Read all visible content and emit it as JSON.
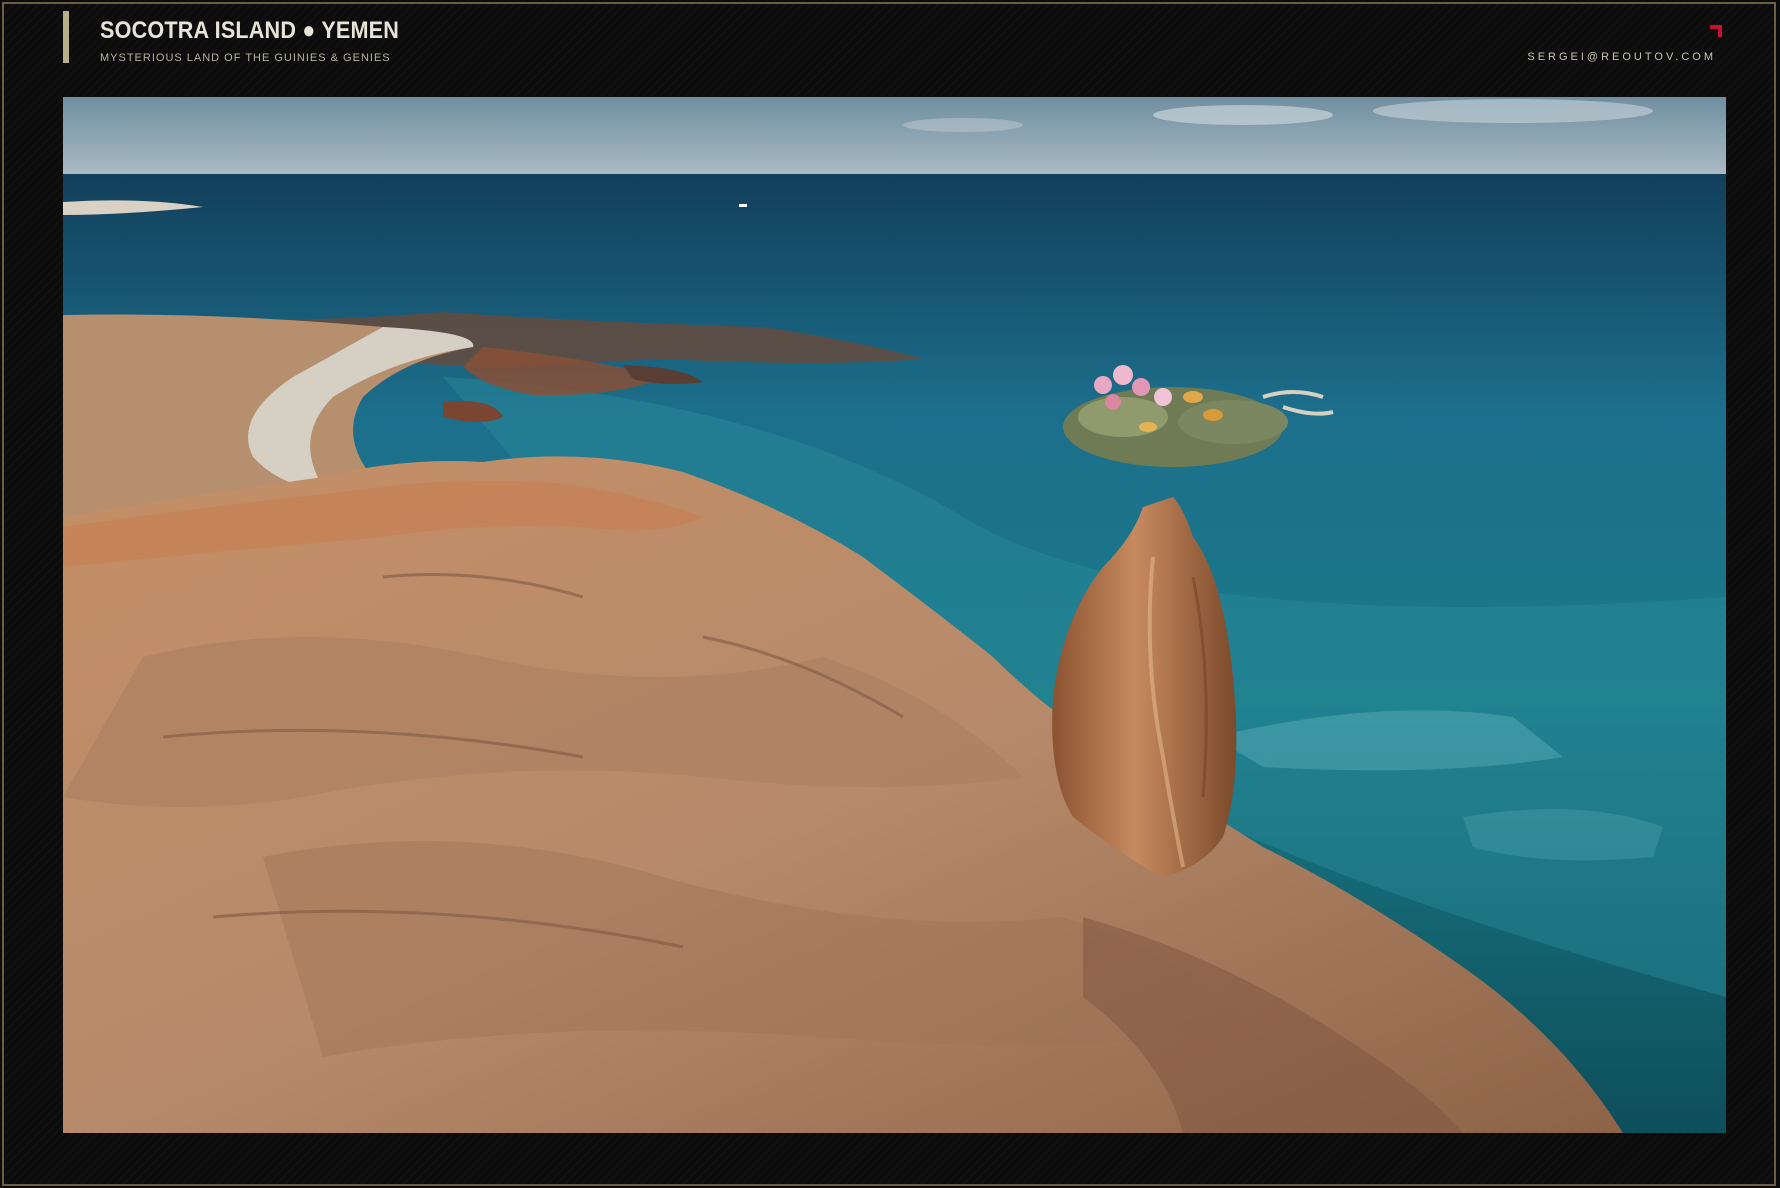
{
  "header": {
    "title": "SOCOTRA ISLAND ● YEMEN",
    "subtitle": "MYSTERIOUS LAND OF THE GUINIES & GENIES",
    "email": "SERGEI@REOUTOV.COM"
  },
  "photo": {
    "subject": "bottle tree on coastal cliff",
    "icon": "corner-mark-icon"
  },
  "colors": {
    "frame_border": "#6d5f3f",
    "accent_bar": "#b9ae8a",
    "corner_mark": "#c8102e",
    "sea": "#1f6f86",
    "rock": "#b8896a"
  }
}
